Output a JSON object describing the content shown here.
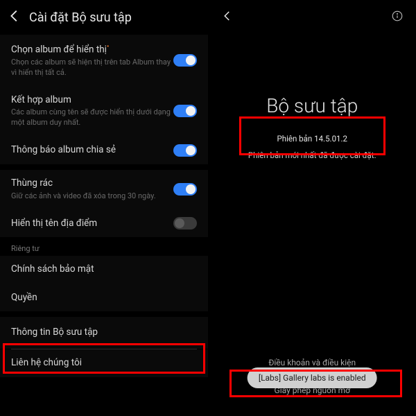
{
  "left": {
    "title": "Cài đặt Bộ sưu tập",
    "rows": {
      "chooseAlbum": {
        "title": "Chọn album để hiển thị",
        "sub": "Chọn các album sẽ hiện thị trên tab Album thay vì hiển thị tất cả."
      },
      "mergeAlbum": {
        "title": "Kết hợp album",
        "sub": "Các album cùng tên sẽ được hiển thị dưới dạng một album duy nhất."
      },
      "sharedNotif": {
        "title": "Thông báo album chia sẻ"
      },
      "trash": {
        "title": "Thùng rác",
        "sub": "Giữ các ảnh và video đã xóa trong 30 ngày."
      },
      "locationName": {
        "title": "Hiển thị tên địa điểm"
      },
      "privacyLabel": "Riêng tư",
      "privacyPolicy": {
        "title": "Chính sách bảo mật"
      },
      "permissions": {
        "title": "Quyền"
      },
      "about": {
        "title": "Thông tin Bộ sưu tập"
      },
      "contact": {
        "title": "Liên hệ chúng tôi"
      }
    }
  },
  "right": {
    "appName": "Bộ sưu tập",
    "versionPrefix": "Phiên bản",
    "version": "14.5.01.2",
    "latest": "Phiên bản mới nhất đã được cài đặt.",
    "links": {
      "terms": "Điều khoản và điều kiện",
      "license": "Giấy phép nguồn mở"
    },
    "toast": "[Labs] Gallery labs is enabled"
  }
}
